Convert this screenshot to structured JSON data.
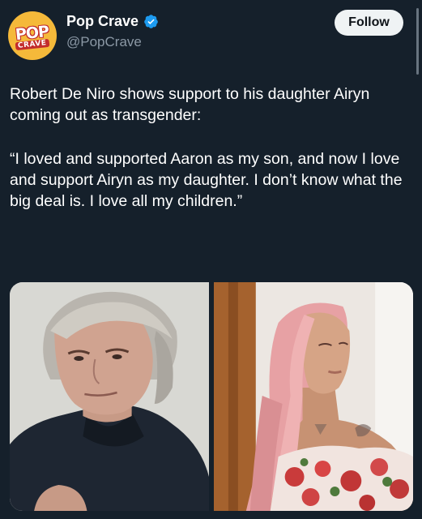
{
  "account": {
    "avatar_text_top": "POP",
    "avatar_text_bottom": "CRAVE",
    "display_name": "Pop Crave",
    "handle": "@PopCrave",
    "verified_icon": "verified-badge-icon"
  },
  "actions": {
    "follow_label": "Follow"
  },
  "tweet": {
    "paragraphs": [
      "Robert De Niro shows support to his daughter Airyn coming out as transgender:",
      "“I loved and supported Aaron as my son, and now I love and support Airyn as my daughter. I don’t know what the big deal is. I love all my children.”"
    ]
  },
  "media": {
    "count": 2
  },
  "colors": {
    "background": "#15202b",
    "text": "#ffffff",
    "secondary_text": "#8b98a5",
    "verified_blue": "#1d9bf0",
    "follow_button_bg": "#eff3f4",
    "brand_yellow": "#f5b93a",
    "brand_red": "#c22c2c"
  }
}
